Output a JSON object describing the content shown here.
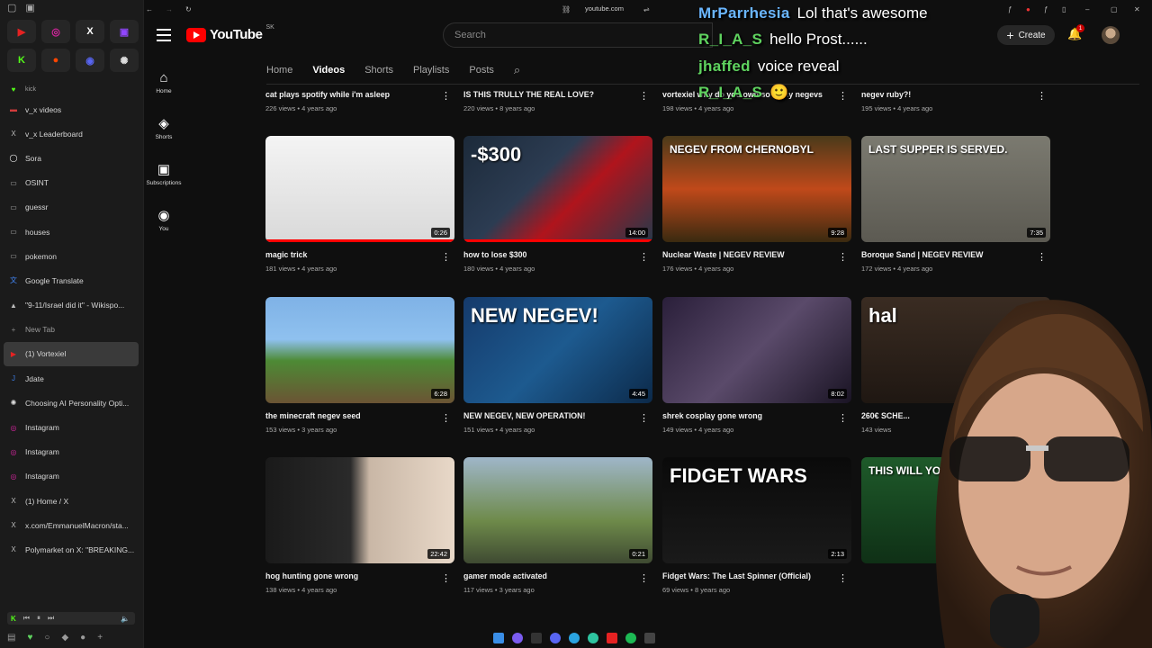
{
  "browser": {
    "url": "youtube.com",
    "pinned": [
      {
        "icon": "youtube-icon",
        "glyph": "▶",
        "color": "#e52222"
      },
      {
        "icon": "instagram-icon",
        "glyph": "◎",
        "color": "#d6249f"
      },
      {
        "icon": "x-icon",
        "glyph": "X",
        "color": "#ffffff"
      },
      {
        "icon": "twitch-icon",
        "glyph": "▣",
        "color": "#9146ff"
      },
      {
        "icon": "kick-icon",
        "glyph": "K",
        "color": "#53fc18"
      },
      {
        "icon": "reddit-icon",
        "glyph": "●",
        "color": "#ff4500"
      },
      {
        "icon": "discord-icon",
        "glyph": "◉",
        "color": "#5865f2"
      },
      {
        "icon": "chatgpt-icon",
        "glyph": "✺",
        "color": "#dddddd"
      }
    ],
    "tabs": [
      {
        "label": "kick",
        "icon": "heart-icon",
        "glyph": "♥",
        "color": "#53fc18",
        "style": "small"
      },
      {
        "label": "v_x videos",
        "icon": "folder-icon",
        "glyph": "▬",
        "color": "#d23c3c",
        "style": ""
      },
      {
        "label": "v_x Leaderboard",
        "icon": "x-icon",
        "glyph": "X",
        "color": "#bbbbbb",
        "style": ""
      },
      {
        "label": "Sora",
        "icon": "sora-icon",
        "glyph": "◯",
        "color": "#ffffff",
        "style": ""
      },
      {
        "label": "OSINT",
        "icon": "folder-icon",
        "glyph": "▭",
        "color": "#aaaaaa",
        "style": ""
      },
      {
        "label": "guessr",
        "icon": "folder-icon",
        "glyph": "▭",
        "color": "#aaaaaa",
        "style": ""
      },
      {
        "label": "houses",
        "icon": "folder-icon",
        "glyph": "▭",
        "color": "#aaaaaa",
        "style": ""
      },
      {
        "label": "pokemon",
        "icon": "folder-icon",
        "glyph": "▭",
        "color": "#aaaaaa",
        "style": ""
      },
      {
        "label": "Google Translate",
        "icon": "translate-icon",
        "glyph": "文",
        "color": "#4285f4",
        "style": ""
      },
      {
        "label": "\"9-11/Israel did it\" - Wikispo...",
        "icon": "triangle-icon",
        "glyph": "▲",
        "color": "#bbbbbb",
        "style": ""
      },
      {
        "label": "New Tab",
        "icon": "plus-icon",
        "glyph": "+",
        "color": "#888888",
        "style": "newtab"
      },
      {
        "label": "(1) Vortexiel",
        "icon": "youtube-icon",
        "glyph": "▶",
        "color": "#e52222",
        "style": "active"
      },
      {
        "label": "Jdate",
        "icon": "jdate-icon",
        "glyph": "J",
        "color": "#3d7be0",
        "style": ""
      },
      {
        "label": "Choosing AI Personality Opti...",
        "icon": "chatgpt-icon",
        "glyph": "✺",
        "color": "#dddddd",
        "style": ""
      },
      {
        "label": "Instagram",
        "icon": "instagram-icon",
        "glyph": "◎",
        "color": "#d6249f",
        "style": ""
      },
      {
        "label": "Instagram",
        "icon": "instagram-icon",
        "glyph": "◎",
        "color": "#d6249f",
        "style": ""
      },
      {
        "label": "Instagram",
        "icon": "instagram-icon",
        "glyph": "◎",
        "color": "#d6249f",
        "style": ""
      },
      {
        "label": "(1) Home / X",
        "icon": "x-icon",
        "glyph": "X",
        "color": "#bbbbbb",
        "style": ""
      },
      {
        "label": "x.com/EmmanuelMacron/sta...",
        "icon": "x-icon",
        "glyph": "X",
        "color": "#bbbbbb",
        "style": ""
      },
      {
        "label": "Polymarket on X: \"BREAKING...",
        "icon": "x-icon",
        "glyph": "X",
        "color": "#bbbbbb",
        "style": ""
      }
    ]
  },
  "youtube": {
    "logo_text": "YouTube",
    "logo_region": "SK",
    "search_placeholder": "Search",
    "create_label": "Create",
    "notification_count": "1",
    "rail": [
      {
        "icon": "home-icon",
        "glyph": "⌂",
        "label": "Home"
      },
      {
        "icon": "shorts-icon",
        "glyph": "◈",
        "label": "Shorts"
      },
      {
        "icon": "subscriptions-icon",
        "glyph": "▣",
        "label": "Subscriptions"
      },
      {
        "icon": "you-icon",
        "glyph": "◉",
        "label": "You"
      }
    ],
    "channel_tabs": [
      "Home",
      "Videos",
      "Shorts",
      "Playlists",
      "Posts"
    ],
    "active_tab": "Videos"
  },
  "videos": [
    {
      "title": "cat plays spotify while i'm asleep",
      "meta": "226 views • 4 years ago"
    },
    {
      "title": "IS THIS TRULLY THE REAL LOVE?",
      "meta": "220 views • 8 years ago"
    },
    {
      "title": "vortexiel why do you own so many negevs",
      "meta": "198 views • 4 years ago"
    },
    {
      "title": "negev ruby?!",
      "meta": "195 views • 4 years ago"
    },
    {
      "title": "magic trick",
      "meta": "181 views • 4 years ago",
      "duration": "0:26",
      "watched": 1.0,
      "bg": "linear-gradient(180deg,#f4f4f4 0%,#d9d9d9 100%)",
      "overlay": ""
    },
    {
      "title": "how to lose $300",
      "meta": "180 views • 4 years ago",
      "duration": "14:00",
      "watched": 1.0,
      "bg": "linear-gradient(135deg,#1c2a3a 0%,#2c3c52 40%,#b0141c 60%,#27384a 100%)",
      "overlay": "-$300"
    },
    {
      "title": "Nuclear Waste | NEGEV REVIEW",
      "meta": "176 views • 4 years ago",
      "duration": "9:28",
      "watched": 0.0,
      "bg": "linear-gradient(180deg,#4a3a1a 0%,#c0491a 50%,#3a2a10 100%)",
      "overlay": "NEGEV FROM CHERNOBYL"
    },
    {
      "title": "Boroque Sand | NEGEV REVIEW",
      "meta": "172 views • 4 years ago",
      "duration": "7:35",
      "watched": 0.0,
      "bg": "linear-gradient(180deg,#7b7a70 0%,#5c5a52 100%)",
      "overlay": "LAST SUPPER IS SERVED."
    },
    {
      "title": "the minecraft negev seed",
      "meta": "153 views • 3 years ago",
      "duration": "6:28",
      "watched": 0.0,
      "bg": "linear-gradient(180deg,#7fb2e6 0%,#8fc1ef 40%,#4d8a35 60%,#6b5434 100%)",
      "overlay": ""
    },
    {
      "title": "NEW NEGEV, NEW OPERATION!",
      "meta": "151 views • 4 years ago",
      "duration": "4:45",
      "watched": 0.0,
      "bg": "linear-gradient(135deg,#153a6b 0%,#1d5a8f 50%,#0c2a4a 100%)",
      "overlay": "NEW NEGEV!"
    },
    {
      "title": "shrek cosplay gone wrong",
      "meta": "149 views • 4 years ago",
      "duration": "8:02",
      "watched": 0.0,
      "bg": "linear-gradient(135deg,#2a1f3a 0%,#5a4a6a 50%,#1a1424 100%)",
      "overlay": ""
    },
    {
      "title": "260€ SCHE...",
      "meta": "143 views",
      "duration": "",
      "watched": 0.0,
      "bg": "linear-gradient(180deg,#3a2c22 0%,#1f1712 100%)",
      "overlay": "hal"
    },
    {
      "title": "hog hunting gone wrong",
      "meta": "138 views • 4 years ago",
      "duration": "22:42",
      "watched": 0.0,
      "bg": "linear-gradient(90deg,#1a1a1a 0%,#2a2a2a 45%,#c9b7a6 55%,#e8d8c8 100%)",
      "overlay": ""
    },
    {
      "title": "gamer mode activated",
      "meta": "117 views • 3 years ago",
      "duration": "0:21",
      "watched": 0.0,
      "bg": "linear-gradient(180deg,#9fb6c9 0%,#6e8a4a 60%,#3f4a32 100%)",
      "overlay": ""
    },
    {
      "title": "Fidget Wars: The Last Spinner (Official)",
      "meta": "69 views • 8 years ago",
      "duration": "2:13",
      "watched": 0.0,
      "bg": "linear-gradient(180deg,#0a0a0a 0%,#1a1a1a 100%)",
      "overlay": "FIDGET WARS"
    },
    {
      "title": "",
      "meta": "",
      "duration": "",
      "watched": 0.0,
      "bg": "linear-gradient(180deg,#1e5a2a 0%,#0f3016 100%)",
      "overlay": "THIS WILL YOU"
    }
  ],
  "chat": [
    {
      "user": "MrParrhesia",
      "message": "Lol that's awesome",
      "user_color": "blue"
    },
    {
      "user": "R_I_A_S",
      "message": "hello Prost......",
      "user_color": "green"
    },
    {
      "user": "jhaffed",
      "message": "voice reveal",
      "user_color": "green"
    },
    {
      "user": "R_I_A_S",
      "message": "🙂",
      "user_color": "green"
    }
  ]
}
